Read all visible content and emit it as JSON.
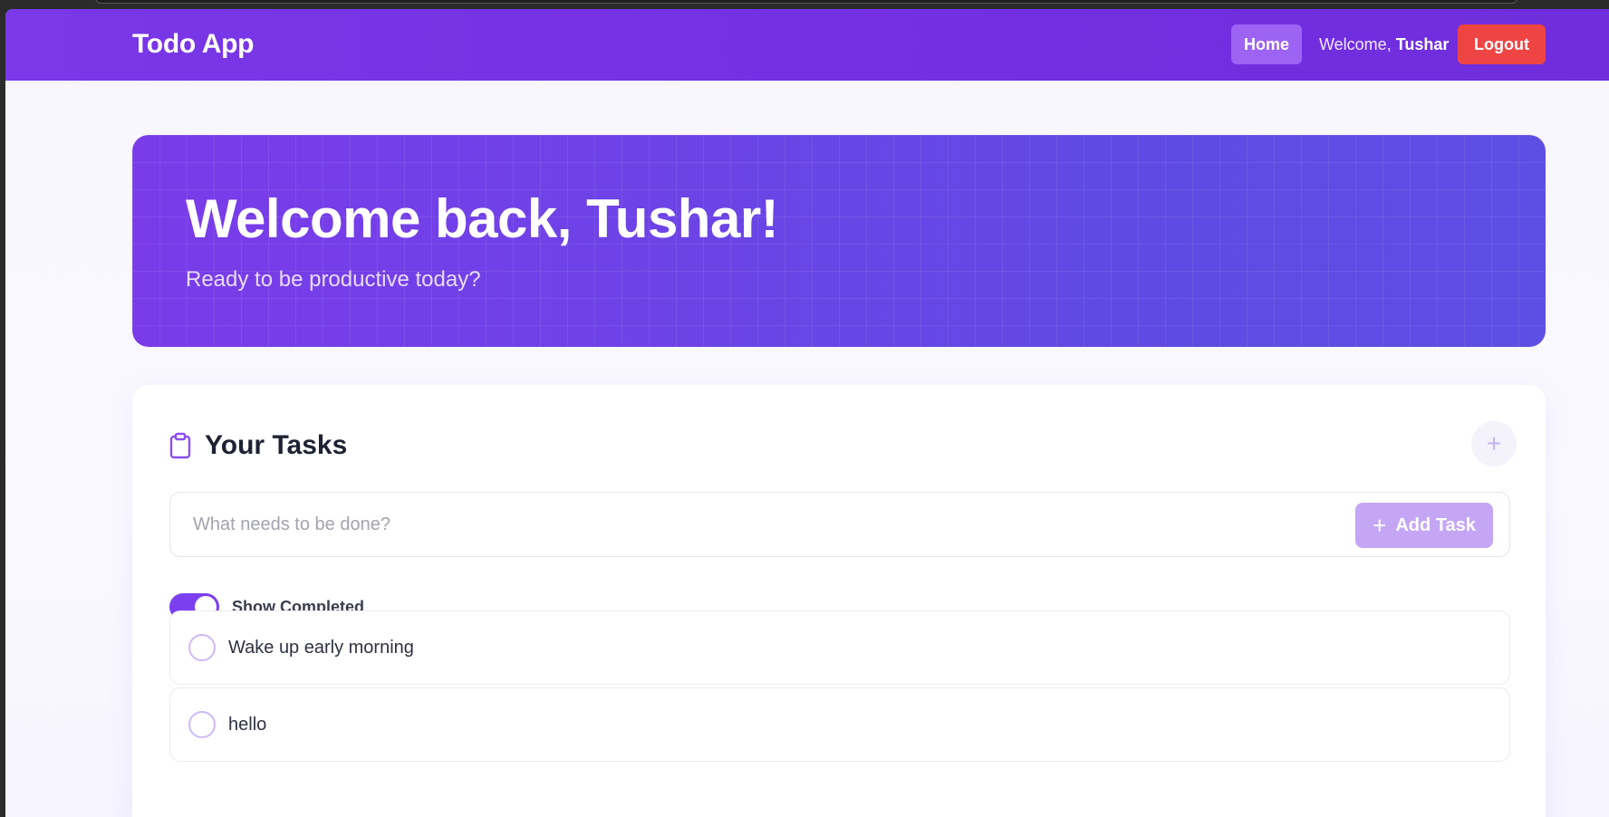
{
  "navbar": {
    "brand": "Todo App",
    "home_label": "Home",
    "welcome_prefix": "Welcome, ",
    "username": "Tushar",
    "logout_label": "Logout"
  },
  "hero": {
    "title": "Welcome back, Tushar!",
    "subtitle": "Ready to be productive today?"
  },
  "tasks_card": {
    "title": "Your Tasks",
    "header_icon": "clipboard-icon",
    "header_add_icon": "plus-icon",
    "input_placeholder": "What needs to be done?",
    "add_button_label": "Add Task",
    "toggle_label": "Show Completed",
    "toggle_on": true,
    "items": [
      {
        "text": "Wake up early morning",
        "completed": false
      },
      {
        "text": "hello",
        "completed": false
      }
    ]
  },
  "colors": {
    "navbar": "#7430e3",
    "accent": "#7b3ff0",
    "logout": "#ef4444",
    "add_button": "#c5a6f5"
  }
}
